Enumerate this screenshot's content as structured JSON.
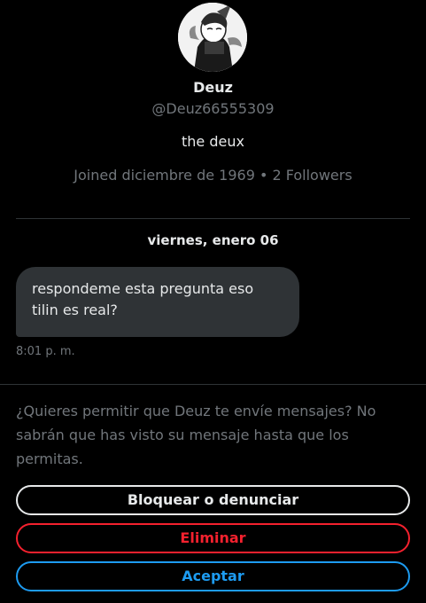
{
  "profile": {
    "name": "Deuz",
    "handle": "@Deuz66555309",
    "bio": "the deux",
    "meta": "Joined diciembre de 1969 • 2 Followers"
  },
  "conversation": {
    "date_separator": "viernes, enero 06",
    "message": {
      "text": "respondeme esta pregunta eso tilin es real?",
      "time": "8:01 p. m."
    }
  },
  "request": {
    "text": "¿Quieres permitir que Deuz te envíe mensajes? No sabrán que has visto su mensaje hasta que los permitas.",
    "block_label": "Bloquear o denunciar",
    "delete_label": "Eliminar",
    "accept_label": "Aceptar"
  },
  "colors": {
    "background": "#000000",
    "text_primary": "#e7e9ea",
    "text_secondary": "#71767b",
    "bubble": "#2f3336",
    "danger": "#f4212e",
    "accent": "#1d9bf0"
  }
}
